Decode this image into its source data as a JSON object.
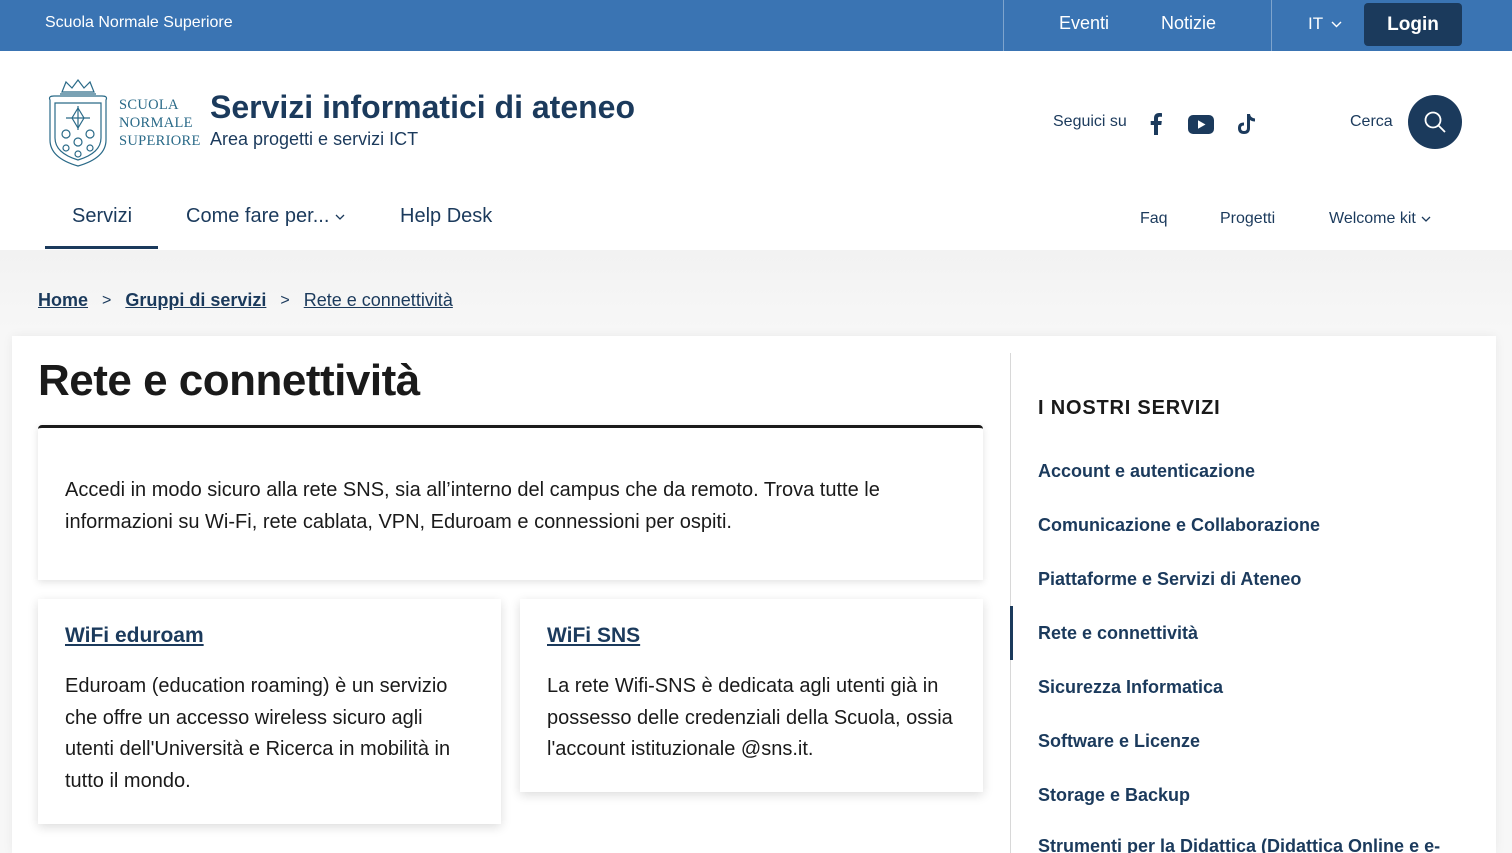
{
  "topbar": {
    "org_name": "Scuola Normale Superiore",
    "links": [
      "Eventi",
      "Notizie"
    ],
    "language": "IT",
    "login_label": "Login"
  },
  "header": {
    "logo_text": [
      "SCUOLA",
      "NORMALE",
      "SUPERIORE"
    ],
    "title": "Servizi informatici di ateneo",
    "subtitle": "Area progetti e servizi ICT",
    "follow_label": "Seguici su",
    "social_icons": [
      "facebook-icon",
      "youtube-icon",
      "tiktok-icon"
    ],
    "search_label": "Cerca"
  },
  "nav": {
    "main": [
      "Servizi",
      "Come fare per...",
      "Help Desk"
    ],
    "secondary": [
      "Faq",
      "Progetti",
      "Welcome kit"
    ]
  },
  "breadcrumb": {
    "items": [
      "Home",
      "Gruppi di servizi"
    ],
    "separator": ">",
    "current": "Rete e connettività"
  },
  "main": {
    "title": "Rete e connettività",
    "intro": "Accedi in modo sicuro alla rete SNS, sia all’interno del campus che da remoto. Trova tutte le informazioni su Wi-Fi, rete cablata, VPN, Eduroam e connessioni per ospiti.",
    "cards": [
      {
        "title": "WiFi eduroam",
        "text": [
          "Eduroam (education roaming) è un servizio",
          "che offre un accesso wireless sicuro agli",
          "utenti dell'Università e Ricerca in mobilità in",
          "tutto il mondo."
        ]
      },
      {
        "title": "WiFi SNS",
        "text": [
          "La rete Wifi-SNS è dedicata agli utenti già in",
          "possesso delle credenziali della Scuola, ossia",
          "l'account istituzionale @sns.it."
        ]
      }
    ]
  },
  "sidebar": {
    "heading": "I NOSTRI SERVIZI",
    "items": [
      "Account e autenticazione",
      "Comunicazione e Collaborazione",
      "Piattaforme e Servizi di Ateneo",
      "Rete e connettività",
      "Sicurezza Informatica",
      "Software e Licenze",
      "Storage e Backup",
      "Strumenti per la Didattica (Didattica Online e e-"
    ],
    "active": "Rete e connettività"
  },
  "colors": {
    "topbar": "#3a74b3",
    "primary": "#1b3a5c",
    "logo": "#2a6a88"
  }
}
